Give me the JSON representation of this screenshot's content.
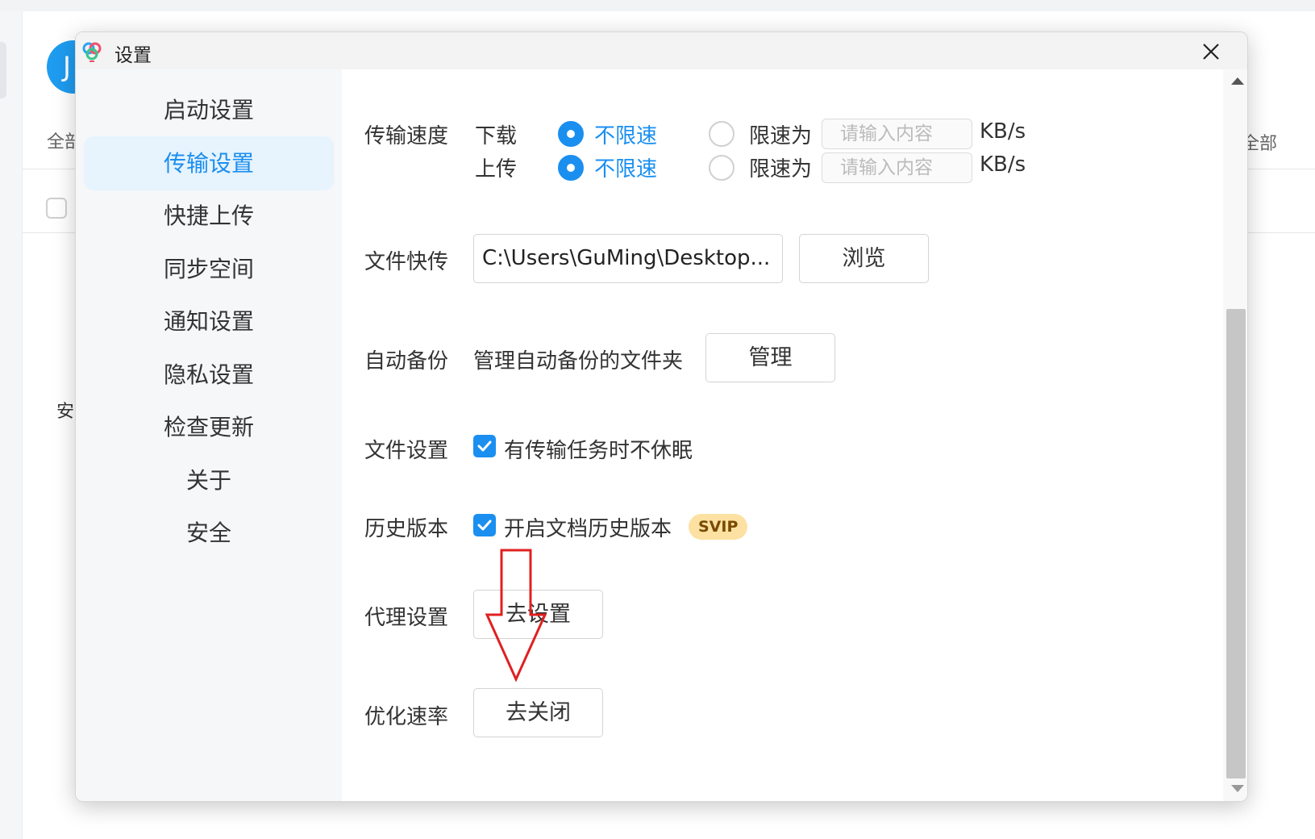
{
  "background": {
    "avatar_char": "J",
    "tab_all_partial": "全部",
    "tab_right_partial": "已全部",
    "side_char": "安"
  },
  "dialog": {
    "title": "设置",
    "close_symbol": "✕"
  },
  "sidebar": {
    "items": [
      {
        "label": "启动设置",
        "active": false
      },
      {
        "label": "传输设置",
        "active": true
      },
      {
        "label": "快捷上传",
        "active": false
      },
      {
        "label": "同步空间",
        "active": false
      },
      {
        "label": "通知设置",
        "active": false
      },
      {
        "label": "隐私设置",
        "active": false
      },
      {
        "label": "检查更新",
        "active": false
      },
      {
        "label": "关于",
        "active": false
      },
      {
        "label": "安全",
        "active": false
      }
    ]
  },
  "transfer_speed": {
    "label": "传输速度",
    "download": {
      "label": "下载",
      "unlimited_label": "不限速",
      "limit_label": "限速为",
      "placeholder": "请输入内容",
      "unit": "KB/s",
      "selected": "unlimited"
    },
    "upload": {
      "label": "上传",
      "unlimited_label": "不限速",
      "limit_label": "限速为",
      "placeholder": "请输入内容",
      "unit": "KB/s",
      "selected": "unlimited"
    }
  },
  "file_quick": {
    "label": "文件快传",
    "path": "C:\\Users\\GuMing\\Desktop...",
    "browse_label": "浏览"
  },
  "auto_backup": {
    "label": "自动备份",
    "description": "管理自动备份的文件夹",
    "manage_label": "管理"
  },
  "file_settings": {
    "label": "文件设置",
    "option_label": "有传输任务时不休眠",
    "checked": true
  },
  "history_version": {
    "label": "历史版本",
    "option_label": "开启文档历史版本",
    "checked": true,
    "badge": "SVIP"
  },
  "proxy": {
    "label": "代理设置",
    "button_label": "去设置"
  },
  "optimize": {
    "label": "优化速率",
    "button_label": "去关闭"
  },
  "colors": {
    "accent": "#1a8ff0",
    "active_nav_bg": "#e7f3fd",
    "badge_bg": "#fde1a2",
    "annotation": "#e02020"
  }
}
